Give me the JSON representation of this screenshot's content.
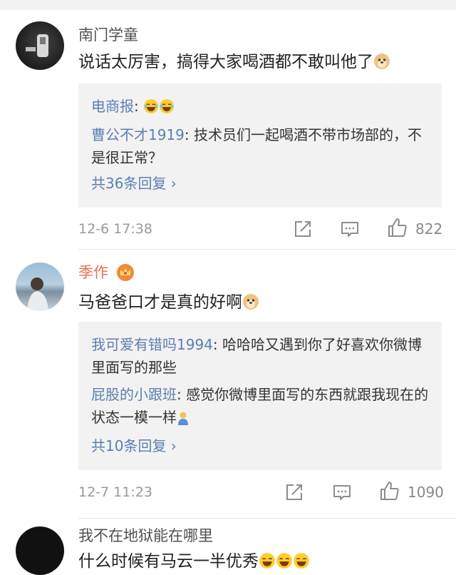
{
  "comments": [
    {
      "username": "南门学童",
      "text": "说话太厉害，搞得大家喝酒都不敢叫他了",
      "replies": [
        {
          "nick": "电商报",
          "text": ":"
        },
        {
          "nick": "曹公不才1919",
          "text": ": 技术员们一起喝酒不带市场部的，不是很正常？"
        }
      ],
      "more": "共36条回复 ›",
      "time": "12-6 17:38",
      "likes": "822"
    },
    {
      "username": "季作",
      "text": "马爸爸口才是真的好啊",
      "replies": [
        {
          "nick": "我可爱有错吗1994",
          "text": ": 哈哈哈又遇到你了好喜欢你微博里面写的那些"
        },
        {
          "nick": "屁股的小跟班",
          "text": ": 感觉你微博里面写的东西就跟我现在的状态一模一样"
        }
      ],
      "more": "共10条回复 ›",
      "time": "12-7 11:23",
      "likes": "1090"
    },
    {
      "username": "我不在地狱能在哪里",
      "text": "什么时候有马云一半优秀"
    }
  ],
  "colors": {
    "link": "#5b7fb1",
    "vip_name": "#eb7350",
    "meta": "#999999"
  },
  "icons": [
    "avatar",
    "doge-emoji",
    "laughing-emoji",
    "crown-icon",
    "share-icon",
    "comment-icon",
    "like-icon"
  ]
}
